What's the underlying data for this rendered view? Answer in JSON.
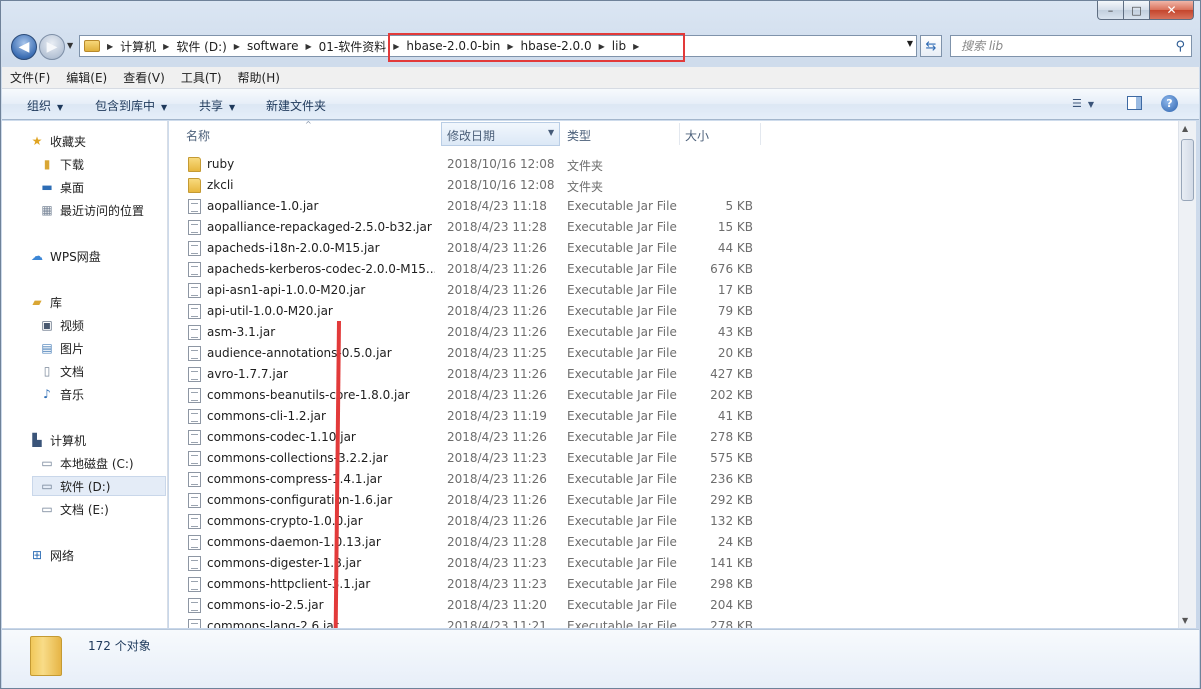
{
  "window": {
    "controls": {
      "minimize": "–",
      "maximize": "□",
      "close": "✕"
    }
  },
  "address_bar": {
    "crumbs": [
      "计算机",
      "软件 (D:)",
      "software",
      "01-软件资料",
      "hbase-2.0.0-bin",
      "hbase-2.0.0",
      "lib"
    ]
  },
  "search": {
    "placeholder": "搜索 lib"
  },
  "menubar": {
    "items": [
      "文件(F)",
      "编辑(E)",
      "查看(V)",
      "工具(T)",
      "帮助(H)"
    ]
  },
  "commandbar": {
    "organize": "组织",
    "include_library": "包含到库中",
    "share": "共享",
    "new_folder": "新建文件夹"
  },
  "navpane": {
    "favorites": "收藏夹",
    "downloads": "下载",
    "desktop": "桌面",
    "recent": "最近访问的位置",
    "wps": "WPS网盘",
    "libraries": "库",
    "videos": "视频",
    "pictures": "图片",
    "documents": "文档",
    "music": "音乐",
    "computer": "计算机",
    "drive_c": "本地磁盘 (C:)",
    "drive_d": "软件 (D:)",
    "drive_e": "文档 (E:)",
    "network": "网络"
  },
  "columns": {
    "name": "名称",
    "date": "修改日期",
    "type": "类型",
    "size": "大小"
  },
  "files": [
    {
      "name": "ruby",
      "date": "2018/10/16 12:08",
      "type": "文件夹",
      "size": "",
      "kind": "folder"
    },
    {
      "name": "zkcli",
      "date": "2018/10/16 12:08",
      "type": "文件夹",
      "size": "",
      "kind": "folder"
    },
    {
      "name": "aopalliance-1.0.jar",
      "date": "2018/4/23 11:18",
      "type": "Executable Jar File",
      "size": "5 KB",
      "kind": "jar"
    },
    {
      "name": "aopalliance-repackaged-2.5.0-b32.jar",
      "date": "2018/4/23 11:28",
      "type": "Executable Jar File",
      "size": "15 KB",
      "kind": "jar"
    },
    {
      "name": "apacheds-i18n-2.0.0-M15.jar",
      "date": "2018/4/23 11:26",
      "type": "Executable Jar File",
      "size": "44 KB",
      "kind": "jar"
    },
    {
      "name": "apacheds-kerberos-codec-2.0.0-M15...",
      "date": "2018/4/23 11:26",
      "type": "Executable Jar File",
      "size": "676 KB",
      "kind": "jar"
    },
    {
      "name": "api-asn1-api-1.0.0-M20.jar",
      "date": "2018/4/23 11:26",
      "type": "Executable Jar File",
      "size": "17 KB",
      "kind": "jar"
    },
    {
      "name": "api-util-1.0.0-M20.jar",
      "date": "2018/4/23 11:26",
      "type": "Executable Jar File",
      "size": "79 KB",
      "kind": "jar"
    },
    {
      "name": "asm-3.1.jar",
      "date": "2018/4/23 11:26",
      "type": "Executable Jar File",
      "size": "43 KB",
      "kind": "jar"
    },
    {
      "name": "audience-annotations-0.5.0.jar",
      "date": "2018/4/23 11:25",
      "type": "Executable Jar File",
      "size": "20 KB",
      "kind": "jar"
    },
    {
      "name": "avro-1.7.7.jar",
      "date": "2018/4/23 11:26",
      "type": "Executable Jar File",
      "size": "427 KB",
      "kind": "jar"
    },
    {
      "name": "commons-beanutils-core-1.8.0.jar",
      "date": "2018/4/23 11:26",
      "type": "Executable Jar File",
      "size": "202 KB",
      "kind": "jar"
    },
    {
      "name": "commons-cli-1.2.jar",
      "date": "2018/4/23 11:19",
      "type": "Executable Jar File",
      "size": "41 KB",
      "kind": "jar"
    },
    {
      "name": "commons-codec-1.10.jar",
      "date": "2018/4/23 11:26",
      "type": "Executable Jar File",
      "size": "278 KB",
      "kind": "jar"
    },
    {
      "name": "commons-collections-3.2.2.jar",
      "date": "2018/4/23 11:23",
      "type": "Executable Jar File",
      "size": "575 KB",
      "kind": "jar"
    },
    {
      "name": "commons-compress-1.4.1.jar",
      "date": "2018/4/23 11:26",
      "type": "Executable Jar File",
      "size": "236 KB",
      "kind": "jar"
    },
    {
      "name": "commons-configuration-1.6.jar",
      "date": "2018/4/23 11:26",
      "type": "Executable Jar File",
      "size": "292 KB",
      "kind": "jar"
    },
    {
      "name": "commons-crypto-1.0.0.jar",
      "date": "2018/4/23 11:26",
      "type": "Executable Jar File",
      "size": "132 KB",
      "kind": "jar"
    },
    {
      "name": "commons-daemon-1.0.13.jar",
      "date": "2018/4/23 11:28",
      "type": "Executable Jar File",
      "size": "24 KB",
      "kind": "jar"
    },
    {
      "name": "commons-digester-1.8.jar",
      "date": "2018/4/23 11:23",
      "type": "Executable Jar File",
      "size": "141 KB",
      "kind": "jar"
    },
    {
      "name": "commons-httpclient-3.1.jar",
      "date": "2018/4/23 11:23",
      "type": "Executable Jar File",
      "size": "298 KB",
      "kind": "jar"
    },
    {
      "name": "commons-io-2.5.jar",
      "date": "2018/4/23 11:20",
      "type": "Executable Jar File",
      "size": "204 KB",
      "kind": "jar"
    },
    {
      "name": "commons-lang-2.6.jar",
      "date": "2018/4/23 11:21",
      "type": "Executable Jar File",
      "size": "278 KB",
      "kind": "jar"
    }
  ],
  "status": {
    "count": "172 个对象"
  },
  "accent": {
    "annotation_red": "#e23a3a",
    "selection": "#e4ecf7"
  }
}
